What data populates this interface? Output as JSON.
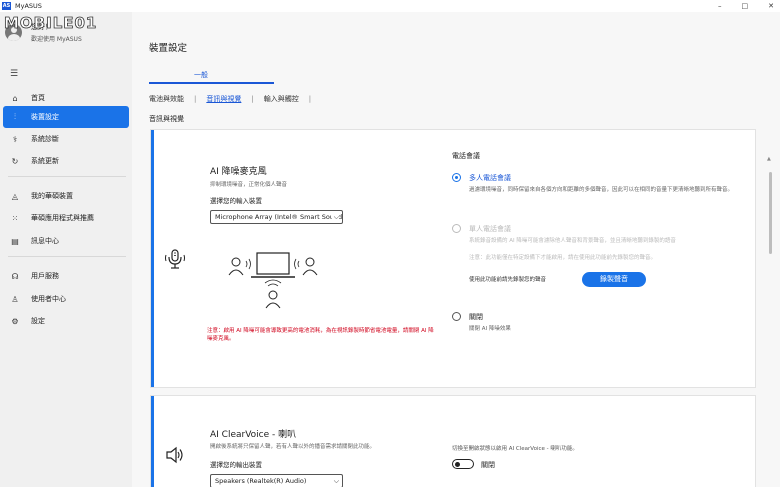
{
  "window": {
    "app_icon_text": "AS",
    "title": "MyASUS",
    "controls": [
      "–",
      "□",
      "✕"
    ]
  },
  "watermark": "MOBILE01",
  "user": {
    "greeting": "您好！",
    "welcome": "歡迎使用 MyASUS"
  },
  "sidebar": {
    "items": [
      {
        "label": "首頁",
        "icon": "home-icon"
      },
      {
        "label": "裝置設定",
        "icon": "sliders-icon"
      },
      {
        "label": "系統診斷",
        "icon": "diagnosis-icon"
      },
      {
        "label": "系統更新",
        "icon": "update-icon"
      },
      {
        "label": "我的華碩裝置",
        "icon": "device-icon"
      },
      {
        "label": "華碩應用程式與推薦",
        "icon": "apps-icon"
      },
      {
        "label": "訊息中心",
        "icon": "message-icon"
      },
      {
        "label": "用戶服務",
        "icon": "headset-icon"
      },
      {
        "label": "使用者中心",
        "icon": "person-icon"
      },
      {
        "label": "設定",
        "icon": "gear-icon"
      }
    ]
  },
  "main": {
    "page_title": "裝置設定",
    "top_tab": "一般",
    "subtabs": [
      "電池與效能",
      "音訊與視覺",
      "輸入與觸控"
    ],
    "section_label": "音訊與視覺"
  },
  "mic_card": {
    "title": "AI 降噪麥克風",
    "desc": "抑制環境噪音，正常化個人聲音",
    "select_label": "選擇您的輸入裝置",
    "select_value": "Microphone Array (Intel® Smart Sound",
    "warning": "注意：啟用 AI 降噪可能會導致更高的電池消耗，為在視訊錄製時節省電池電量，請關閉 AI 降噪麥克風。",
    "group_title": "電話會議",
    "options": [
      {
        "label": "多人電話會議",
        "desc": "過濾環境噪音，同時保留來自各個方向和距離的多個聲音，因此可以在相同的音量下更清晰地聽到所有聲音。",
        "state": "checked"
      },
      {
        "label": "單人電話會議",
        "desc": "系統錄音設備的 AI 降噪可能會濾除他人聲音和背景聲音，並且清晰地聽到錄製的語音",
        "desc2": "注意：此功能僅在特定設備下才能啟用，請在使用此功能前先錄製您的聲音。",
        "state": "disabled"
      },
      {
        "label": "關閉",
        "desc": "關閉 AI 降噪效果",
        "state": "unchecked"
      }
    ],
    "record_hint": "使用此功能前請先錄製您的聲音",
    "record_button": "錄製聲音"
  },
  "speaker_card": {
    "title": "AI ClearVoice - 喇叭",
    "desc": "開啟後系統將只保留人聲，若有人聲以外的播音需求請關閉此功能。",
    "select_label": "選擇您的輸出裝置",
    "select_value": "Speakers (Realtek(R) Audio)",
    "switch_hint": "切換至開啟狀態以啟用 AI ClearVoice - 喇叭功能。",
    "toggle_label": "關閉",
    "toggle_state": "off"
  }
}
